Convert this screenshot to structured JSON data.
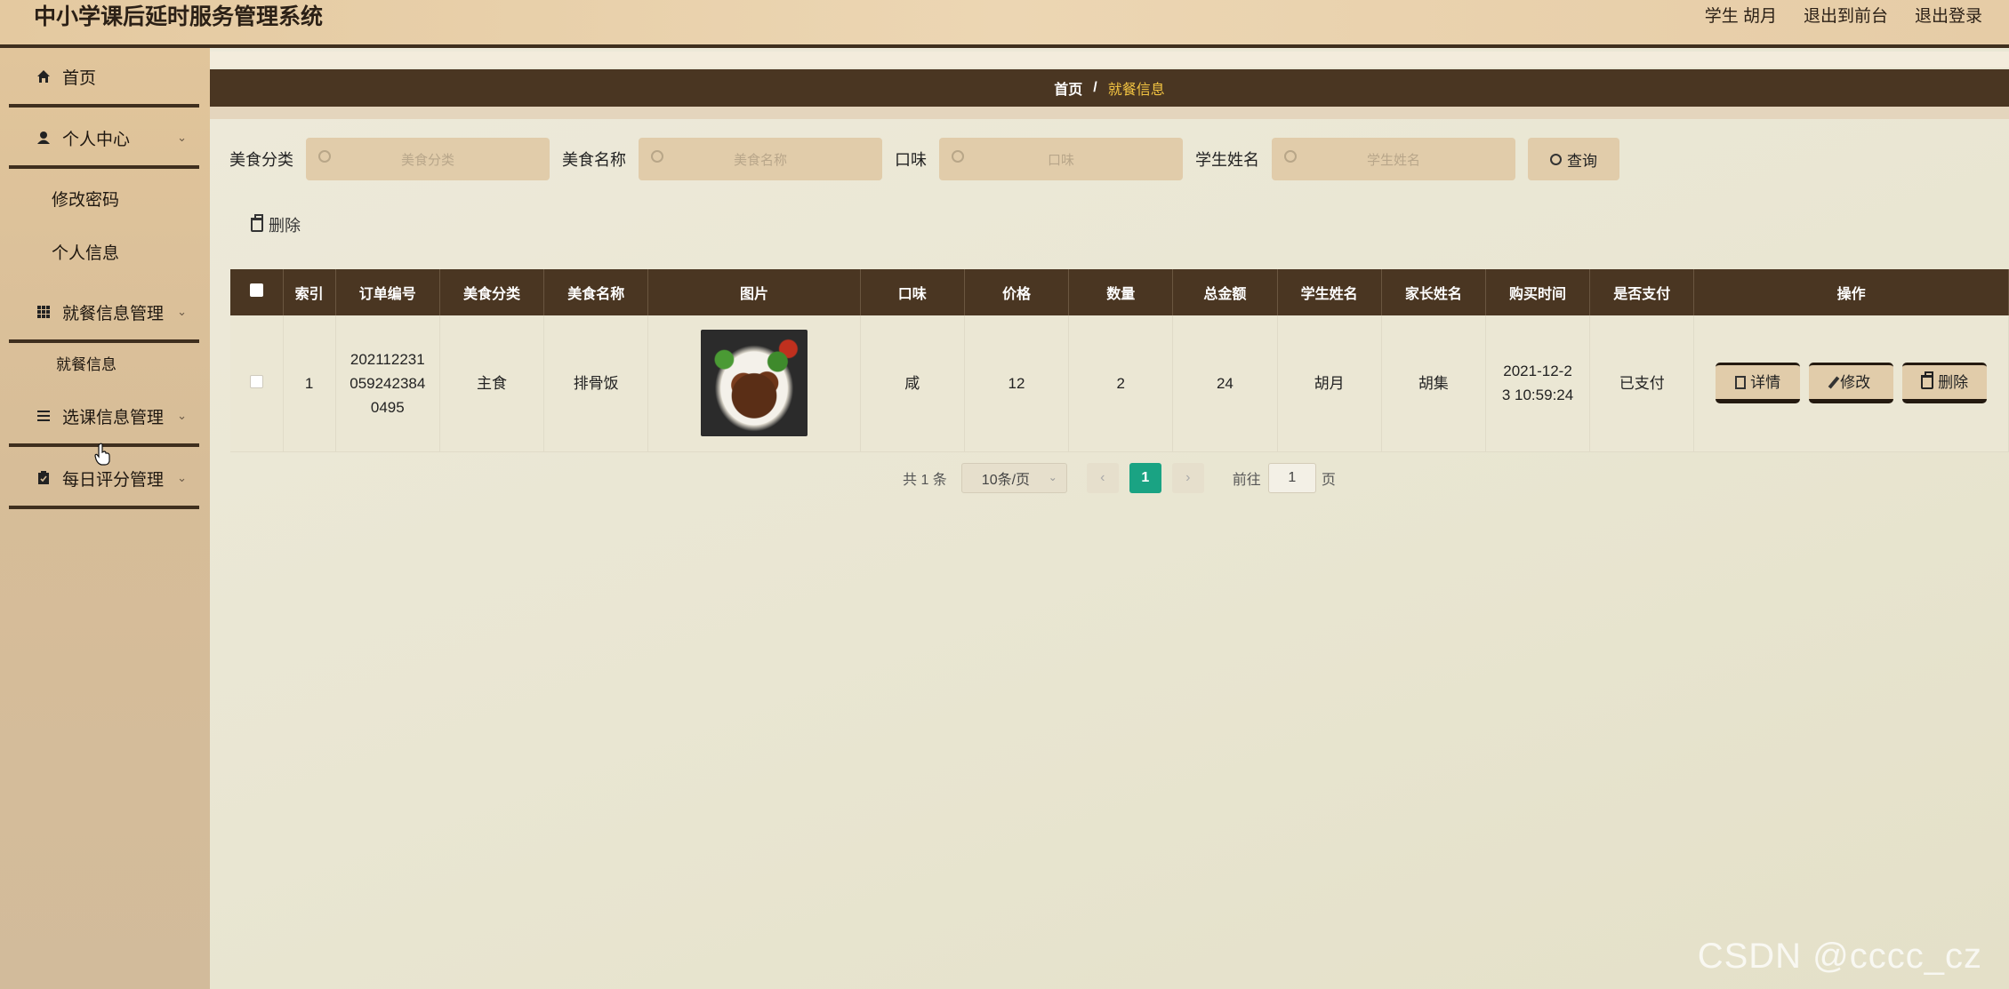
{
  "header": {
    "app_title": "中小学课后延时服务管理系统",
    "user_label": "学生 胡月",
    "back_frontend": "退出到前台",
    "logout": "退出登录"
  },
  "sidebar": {
    "items": [
      {
        "label": "首页",
        "icon": "home-icon"
      },
      {
        "label": "个人中心",
        "icon": "user-icon"
      },
      {
        "label": "修改密码"
      },
      {
        "label": "个人信息"
      },
      {
        "label": "就餐信息管理",
        "icon": "grid-icon"
      },
      {
        "label": "就餐信息"
      },
      {
        "label": "选课信息管理",
        "icon": "list-icon"
      },
      {
        "label": "每日评分管理",
        "icon": "clipboard-icon"
      }
    ],
    "visible_partial_label": "选课",
    "visible_partial_label_2": "息管理"
  },
  "breadcrumb": {
    "home": "首页",
    "sep": "/",
    "current": "就餐信息"
  },
  "search": {
    "f1_label": "美食分类",
    "f1_placeholder": "美食分类",
    "f2_label": "美食名称",
    "f2_placeholder": "美食名称",
    "f3_label": "口味",
    "f3_placeholder": "口味",
    "f4_label": "学生姓名",
    "f4_placeholder": "学生姓名",
    "query_button": "查询"
  },
  "toolbar": {
    "delete_label": "删除"
  },
  "table": {
    "headers": [
      "索引",
      "订单编号",
      "美食分类",
      "美食名称",
      "图片",
      "口味",
      "价格",
      "数量",
      "总金额",
      "学生姓名",
      "家长姓名",
      "购买时间",
      "是否支付",
      "操作"
    ],
    "rows": [
      {
        "index": "1",
        "order_no_l1": "202112231",
        "order_no_l2": "059242384",
        "order_no_l3": "0495",
        "category": "主食",
        "food_name": "排骨饭",
        "taste": "咸",
        "price": "12",
        "quantity": "2",
        "total": "24",
        "student": "胡月",
        "parent": "胡集",
        "time_l1": "2021-12-2",
        "time_l2": "3 10:59:24",
        "paid": "已支付",
        "detail_btn": "详情",
        "edit_btn": "修改",
        "delete_btn": "删除"
      }
    ]
  },
  "pagination": {
    "total": "共 1 条",
    "page_size": "10条/页",
    "current_page": "1",
    "goto_label": "前往",
    "goto_value": "1",
    "page_unit": "页"
  },
  "watermark": "CSDN @cccc_cz",
  "colors": {
    "dark_brown": "#4a3622",
    "tan": "#e1ccaa",
    "accent_green": "#1aa383",
    "breadcrumb_current": "#f4c542"
  }
}
